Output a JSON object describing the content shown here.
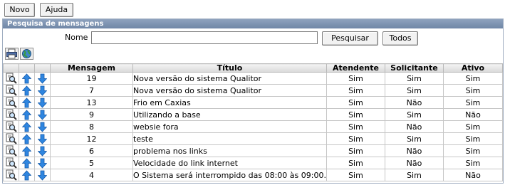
{
  "toolbar": {
    "new_label": "Novo",
    "help_label": "Ajuda"
  },
  "panel": {
    "title": "Pesquisa de mensagens"
  },
  "search": {
    "name_label": "Nome :",
    "name_value": "",
    "search_button": "Pesquisar",
    "all_button": "Todos"
  },
  "icons": {
    "print": "print-icon",
    "globe": "globe-icon",
    "view": "magnifier-icon",
    "up": "arrow-up-icon",
    "down": "arrow-down-icon"
  },
  "table": {
    "headers": [
      "Mensagem",
      "Título",
      "Atendente",
      "Solicitante",
      "Ativo"
    ],
    "rows": [
      {
        "mensagem": "19",
        "titulo": "Nova versão do sistema Qualitor",
        "atendente": "Sim",
        "solicitante": "Sim",
        "ativo": "Sim"
      },
      {
        "mensagem": "7",
        "titulo": "Nova versão do sistema Qualitor",
        "atendente": "Sim",
        "solicitante": "Sim",
        "ativo": "Sim"
      },
      {
        "mensagem": "13",
        "titulo": "Frio em Caxias",
        "atendente": "Sim",
        "solicitante": "Não",
        "ativo": "Sim"
      },
      {
        "mensagem": "9",
        "titulo": "Utilizando a base",
        "atendente": "Sim",
        "solicitante": "Sim",
        "ativo": "Não"
      },
      {
        "mensagem": "8",
        "titulo": "websie fora",
        "atendente": "Sim",
        "solicitante": "Não",
        "ativo": "Sim"
      },
      {
        "mensagem": "12",
        "titulo": "teste",
        "atendente": "Sim",
        "solicitante": "Sim",
        "ativo": "Sim"
      },
      {
        "mensagem": "6",
        "titulo": "problema nos links",
        "atendente": "Sim",
        "solicitante": "Não",
        "ativo": "Sim"
      },
      {
        "mensagem": "5",
        "titulo": "Velocidade do link internet",
        "atendente": "Sim",
        "solicitante": "Não",
        "ativo": "Sim"
      },
      {
        "mensagem": "4",
        "titulo": "O Sistema será interrompido das 08:00 às 09:00.",
        "atendente": "Sim",
        "solicitante": "Sim",
        "ativo": "Não"
      }
    ]
  },
  "colors": {
    "panel_header": "#7d92b2",
    "arrow_blue": "#2f86e0"
  }
}
